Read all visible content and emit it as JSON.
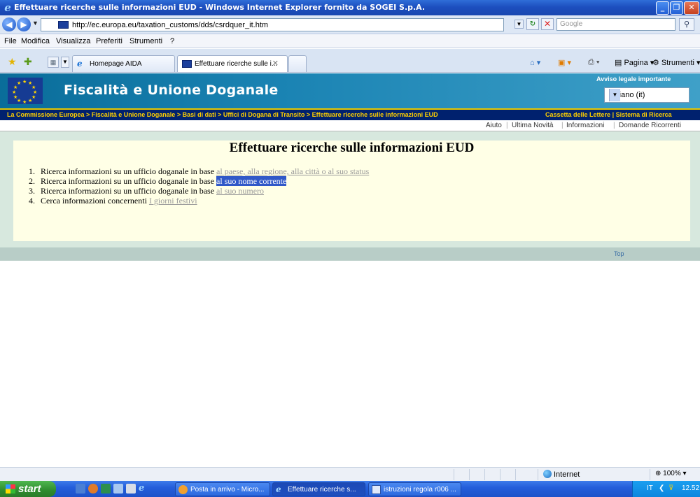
{
  "window": {
    "title": "Effettuare ricerche sulle informazioni EUD - Windows Internet Explorer fornito da SOGEI S.p.A."
  },
  "addressbar": {
    "url": "http://ec.europa.eu/taxation_customs/dds/csrdquer_it.htm",
    "search_placeholder": "Google"
  },
  "menu": [
    "File",
    "Modifica",
    "Visualizza",
    "Preferiti",
    "Strumenti",
    "?"
  ],
  "tabs": [
    {
      "label": "Homepage AIDA"
    },
    {
      "label": "Effettuare ricerche sulle i..."
    }
  ],
  "commandbar": {
    "page_label": "Pagina",
    "tools_label": "Strumenti"
  },
  "banner": {
    "title": "Fiscalità e Unione Doganale",
    "legal_notice": "Avviso legale importante",
    "language": "Italiano (it)"
  },
  "breadcrumb": {
    "path": "La Commissione Europea > Fiscalità e Unione Doganale > Basi di dati > Uffici di Dogana di Transito > Effettuare ricerche sulle informazioni EUD",
    "mailbox": "Cassetta delle Lettere",
    "search_system": "Sistema di Ricerca",
    "separator": "|"
  },
  "utility_links": [
    "Aiuto",
    "Ultima Novità",
    "Informazioni",
    "Domande Ricorrenti"
  ],
  "content": {
    "heading": "Effettuare ricerche sulle informazioni EUD",
    "items": [
      {
        "num": "1.",
        "text": "Ricerca informazioni su un ufficio doganale in base ",
        "link": "al paese, alla regione, alla città o al suo status"
      },
      {
        "num": "2.",
        "text": "Ricerca informazioni su un ufficio doganale in base ",
        "link": "al suo nome corrente"
      },
      {
        "num": "3.",
        "text": "Ricerca informazioni su un ufficio doganale in base ",
        "link": "al suo numero"
      },
      {
        "num": "4.",
        "text": "Cerca informazioni concernenti ",
        "link": "I giorni festivi"
      }
    ],
    "top_link": "Top"
  },
  "statusbar": {
    "zone": "Internet",
    "zoom": "100%"
  },
  "taskbar": {
    "start": "start",
    "tasks": [
      {
        "label": "Posta in arrivo - Micro..."
      },
      {
        "label": "Effettuare ricerche s..."
      },
      {
        "label": "istruzioni regola r006 ..."
      }
    ],
    "language": "IT",
    "time": "12.52"
  },
  "colors": {
    "banner": "#1a83b3",
    "breadcrumb_bg": "#00216e",
    "breadcrumb_text": "#ffd000",
    "content_bg": "#ffffe6",
    "selected_link": "#3058c8"
  }
}
